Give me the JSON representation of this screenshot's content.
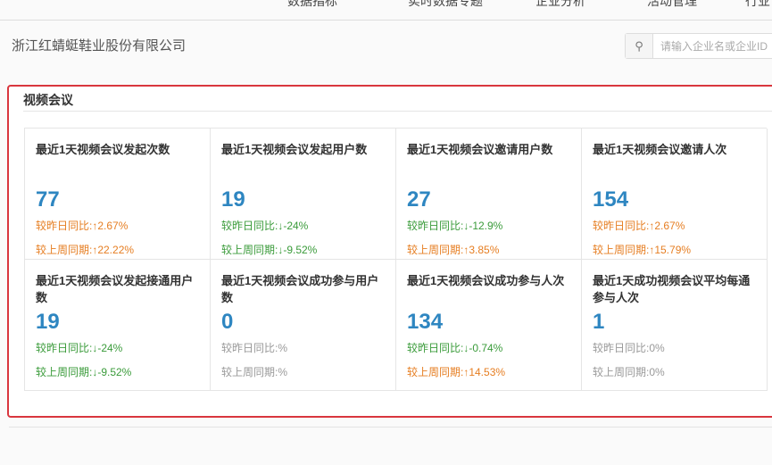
{
  "nav": [
    "数据指标",
    "实时数据专题",
    "企业分析",
    "活动管理",
    "行业"
  ],
  "company": "浙江红蜻蜓鞋业股份有限公司",
  "search": {
    "placeholder": "请输入企业名或企业ID",
    "icon": "search-icon"
  },
  "section_title": "视频会议",
  "cards": [
    {
      "title": "最近1天视频会议发起次数",
      "value": "77",
      "day": "较昨日同比:↑2.67%",
      "day_trend": "up",
      "week": "较上周同期:↑22.22%",
      "week_trend": "up"
    },
    {
      "title": "最近1天视频会议发起用户数",
      "value": "19",
      "day": "较昨日同比:↓-24%",
      "day_trend": "down",
      "week": "较上周同期:↓-9.52%",
      "week_trend": "down"
    },
    {
      "title": "最近1天视频会议邀请用户数",
      "value": "27",
      "day": "较昨日同比:↓-12.9%",
      "day_trend": "down",
      "week": "较上周同期:↑3.85%",
      "week_trend": "up"
    },
    {
      "title": "最近1天视频会议邀请人次",
      "value": "154",
      "day": "较昨日同比:↑2.67%",
      "day_trend": "up",
      "week": "较上周同期:↑15.79%",
      "week_trend": "up"
    },
    {
      "title": "最近1天视频会议发起接通用户数",
      "value": "19",
      "day": "较昨日同比:↓-24%",
      "day_trend": "down",
      "week": "较上周同期:↓-9.52%",
      "week_trend": "down"
    },
    {
      "title": "最近1天视频会议成功参与用户数",
      "value": "0",
      "day": "较昨日同比:%",
      "day_trend": "flat",
      "week": "较上周同期:%",
      "week_trend": "flat"
    },
    {
      "title": "最近1天视频会议成功参与人次",
      "value": "134",
      "day": "较昨日同比:↓-0.74%",
      "day_trend": "down",
      "week": "较上周同期:↑14.53%",
      "week_trend": "up"
    },
    {
      "title": "最近1天成功视频会议平均每通参与人次",
      "value": "1",
      "day": "较昨日同比:0%",
      "day_trend": "flat",
      "week": "较上周同期:0%",
      "week_trend": "flat"
    }
  ]
}
